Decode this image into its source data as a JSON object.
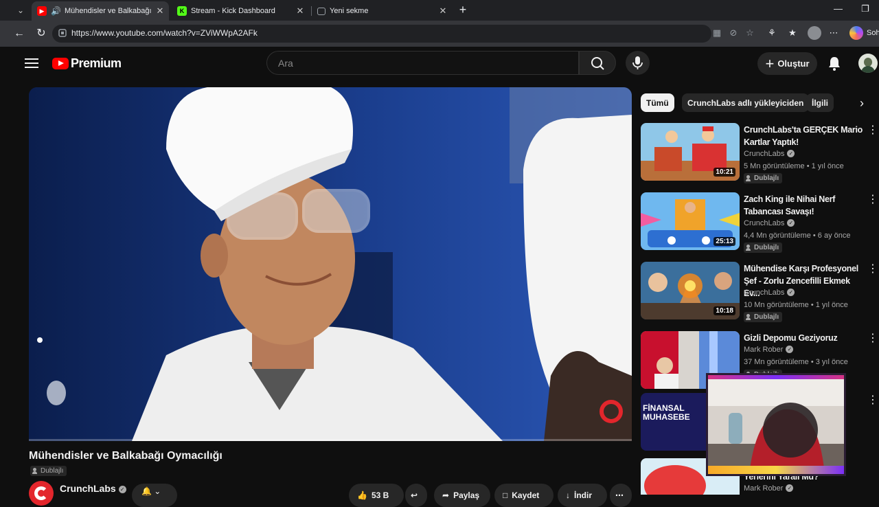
{
  "browser": {
    "tabs": [
      {
        "title": "Mühendisler ve Balkabağı Oyma",
        "active": true,
        "audio": true
      },
      {
        "title": "Stream - Kick Dashboard",
        "active": false
      },
      {
        "title": "Yeni sekme",
        "active": false
      }
    ],
    "url": "https://www.youtube.com/watch?v=ZViWWpA2AFk",
    "copilot_label": "Soh",
    "colors": {
      "kick_green": "#53fc18",
      "youtube_red": "#ff0000"
    }
  },
  "youtube": {
    "logo_text": "Premium",
    "search_placeholder": "Ara",
    "create_label": "Oluştur"
  },
  "video": {
    "title": "Mühendisler ve Balkabağı Oymacılığı",
    "dubbed_label": "Dublajlı",
    "channel": "CrunchLabs",
    "likes": "53 B",
    "share_label": "Paylaş",
    "save_label": "Kaydet",
    "download_label": "İndir",
    "progress": 0.0
  },
  "chips": [
    "Tümü",
    "CrunchLabs adlı yükleyiciden",
    "İlgili"
  ],
  "recommendations": [
    {
      "title": "CrunchLabs'ta GERÇEK Mario Kartlar Yaptık!",
      "channel": "CrunchLabs",
      "meta": "5 Mn görüntüleme • 1 yıl önce",
      "badge": "Dublajlı",
      "duration": "10:21"
    },
    {
      "title": "Zach King ile Nihai Nerf Tabancası Savaşı!",
      "channel": "CrunchLabs",
      "meta": "4,4 Mn görüntüleme • 6 ay önce",
      "badge": "Dublajlı",
      "duration": "25:13"
    },
    {
      "title": "Mühendise Karşı Profesyonel Şef - Zorlu Zencefilli Ekmek Ev...",
      "channel": "CrunchLabs",
      "meta": "10 Mn görüntüleme • 1 yıl önce",
      "badge": "Dublajlı",
      "duration": "10:18"
    },
    {
      "title": "Gizli Depomu Geziyoruz",
      "channel": "Mark Rober",
      "meta": "37 Mn görüntüleme • 3 yıl önce",
      "badge": "Dublajlı",
      "duration": ""
    },
    {
      "title": "",
      "channel": "",
      "meta": "",
      "badge": "",
      "duration": "",
      "thumb_text_1": "FİNANSAL",
      "thumb_text_2": "MUHASEBE"
    },
    {
      "title": "Yerlerini Yaralı Mu?",
      "channel": "Mark Rober",
      "meta": "",
      "badge": "",
      "duration": ""
    }
  ]
}
